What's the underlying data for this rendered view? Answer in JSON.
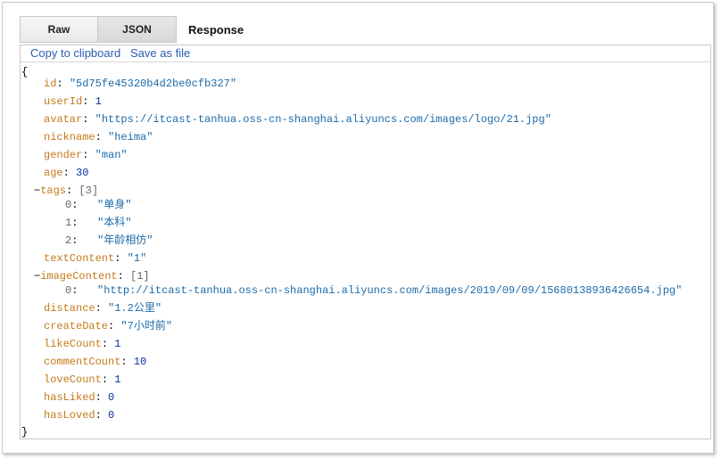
{
  "tabs": [
    {
      "label": "Raw"
    },
    {
      "label": "JSON"
    }
  ],
  "section_title": "Response",
  "actions": {
    "copy_label": "Copy to clipboard",
    "save_label": "Save as file"
  },
  "json": {
    "open_brace": "{",
    "close_brace": "}",
    "collapse_symbol": "−",
    "fields": {
      "id": {
        "key": "id",
        "value": "\"5d75fe45320b4d2be0cfb327\""
      },
      "userId": {
        "key": "userId",
        "value": "1"
      },
      "avatar": {
        "key": "avatar",
        "value": "\"https://itcast-tanhua.oss-cn-shanghai.aliyuncs.com/images/logo/21.jpg\""
      },
      "nickname": {
        "key": "nickname",
        "value": "\"heima\""
      },
      "gender": {
        "key": "gender",
        "value": "\"man\""
      },
      "age": {
        "key": "age",
        "value": "30"
      },
      "tags": {
        "key": "tags",
        "count": "[3]",
        "items": [
          {
            "index": "0",
            "value": "\"单身\""
          },
          {
            "index": "1",
            "value": "\"本科\""
          },
          {
            "index": "2",
            "value": "\"年龄相仿\""
          }
        ]
      },
      "textContent": {
        "key": "textContent",
        "value": "\"1\""
      },
      "imageContent": {
        "key": "imageContent",
        "count": "[1]",
        "items": [
          {
            "index": "0",
            "value": "\"http://itcast-tanhua.oss-cn-shanghai.aliyuncs.com/images/2019/09/09/15680138936426654.jpg\""
          }
        ]
      },
      "distance": {
        "key": "distance",
        "value": "\"1.2公里\""
      },
      "createDate": {
        "key": "createDate",
        "value": "\"7小时前\""
      },
      "likeCount": {
        "key": "likeCount",
        "value": "1"
      },
      "commentCount": {
        "key": "commentCount",
        "value": "10"
      },
      "loveCount": {
        "key": "loveCount",
        "value": "1"
      },
      "hasLiked": {
        "key": "hasLiked",
        "value": "0"
      },
      "hasLoved": {
        "key": "hasLoved",
        "value": "0"
      }
    }
  }
}
